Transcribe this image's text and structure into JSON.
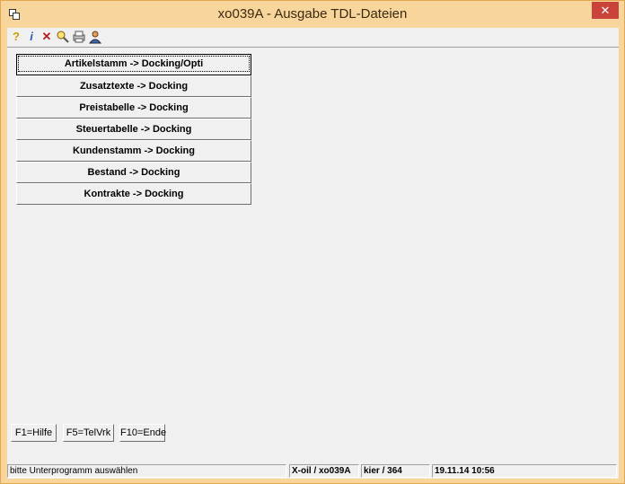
{
  "window": {
    "title": "xo039A - Ausgabe TDL-Dateien",
    "close_label": "✕"
  },
  "toolbar": {
    "icons": [
      "help-icon",
      "info-icon",
      "delete-icon",
      "search-icon",
      "print-icon",
      "user-icon"
    ]
  },
  "menu": {
    "items": [
      {
        "label": "Artikelstamm -> Docking/Opti"
      },
      {
        "label": "Zusatztexte -> Docking"
      },
      {
        "label": "Preistabelle -> Docking"
      },
      {
        "label": "Steuertabelle -> Docking"
      },
      {
        "label": "Kundenstamm -> Docking"
      },
      {
        "label": "Bestand -> Docking"
      },
      {
        "label": "Kontrakte -> Docking"
      }
    ]
  },
  "fkeys": {
    "help": "F1=Hilfe",
    "telvrk": "F5=TelVrk",
    "end": "F10=Ende"
  },
  "status": {
    "message": "bitte Unterprogramm auswählen",
    "program": "X-oil / xo039A",
    "user": "kier / 364",
    "datetime": "19.11.14 10:56"
  }
}
